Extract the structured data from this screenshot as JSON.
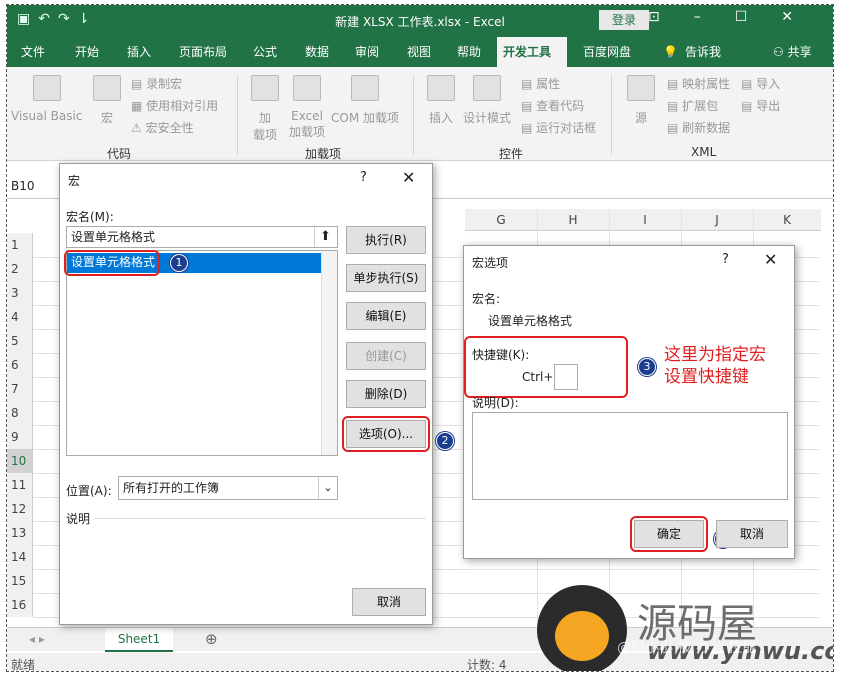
{
  "window": {
    "title": "新建 XLSX 工作表.xlsx - Excel",
    "login": "登录",
    "share": "共享"
  },
  "tabs": [
    "文件",
    "开始",
    "插入",
    "页面布局",
    "公式",
    "数据",
    "审阅",
    "视图",
    "帮助",
    "开发工具",
    "百度网盘",
    "告诉我"
  ],
  "ribbon": {
    "code": {
      "visual_basic": "Visual Basic",
      "macro": "宏",
      "record": "录制宏",
      "relative": "使用相对引用",
      "security": "宏安全性",
      "group": "代码"
    },
    "addins": {
      "addin": "加\n载项",
      "excel_addin": "Excel\n加载项",
      "com": "COM 加载项",
      "group": "加载项"
    },
    "controls": {
      "insert": "插入",
      "design": "设计模式",
      "props": "属性",
      "view_code": "查看代码",
      "run_dialog": "运行对话框",
      "group": "控件"
    },
    "xml": {
      "source": "源",
      "map_props": "映射属性",
      "expand": "扩展包",
      "refresh": "刷新数据",
      "import": "导入",
      "export": "导出",
      "group": "XML"
    }
  },
  "namebox": "B10",
  "columns": [
    "G",
    "H",
    "I",
    "J",
    "K"
  ],
  "rows": [
    "1",
    "2",
    "3",
    "4",
    "5",
    "6",
    "7",
    "8",
    "9",
    "10",
    "11",
    "12",
    "13",
    "14",
    "15",
    "16"
  ],
  "sheet_tab": "Sheet1",
  "status": {
    "left": "就绪",
    "count": "计数: 4"
  },
  "macro_dialog": {
    "title": "宏",
    "help": "?",
    "macro_name_label": "宏名(M):",
    "macro_name_value": "设置单元格格式",
    "list_items": [
      "设置单元格格式"
    ],
    "location_label": "位置(A):",
    "location_value": "所有打开的工作簿",
    "description_label": "说明",
    "buttons": {
      "run": "执行(R)",
      "step": "单步执行(S)",
      "edit": "编辑(E)",
      "create": "创建(C)",
      "delete": "删除(D)",
      "options": "选项(O)...",
      "cancel": "取消"
    }
  },
  "options_dialog": {
    "title": "宏选项",
    "help": "?",
    "macro_name_label": "宏名:",
    "macro_name_value": "设置单元格格式",
    "shortcut_label": "快捷键(K):",
    "ctrl_prefix": "Ctrl+",
    "shortcut_value": "",
    "description_label": "说明(D):",
    "ok": "确定",
    "cancel": "取消"
  },
  "annotations": {
    "badges": [
      "1",
      "2",
      "3",
      "4"
    ],
    "note": "这里为指定宏\n设置快捷键",
    "accent": "#e02020",
    "badge_color": "#1a3d8f"
  },
  "watermark": {
    "brand": "源码屋",
    "url": "www.ymwu.com",
    "caption": "@职小小 被 办公 技能"
  },
  "colors": {
    "excel_green": "#217346",
    "selection_blue": "#0078d7"
  }
}
